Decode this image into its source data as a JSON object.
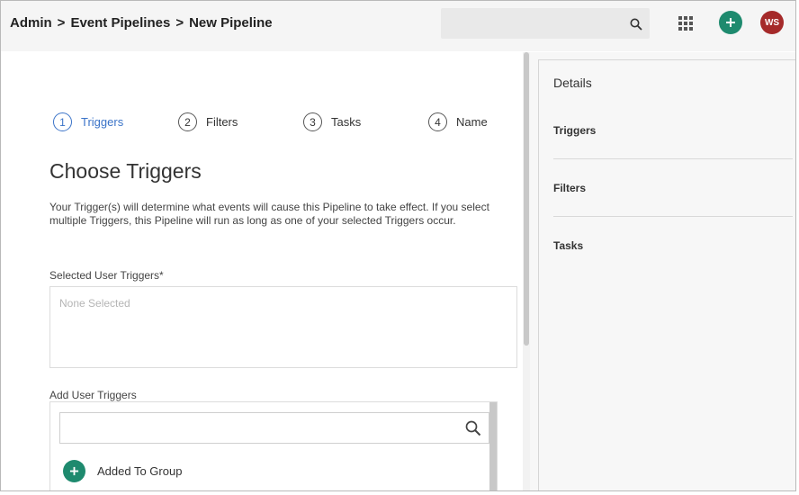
{
  "breadcrumb": [
    "Admin",
    "Event Pipelines",
    "New Pipeline"
  ],
  "breadcrumb_sep": ">",
  "search": {
    "placeholder": "",
    "icon": "search-icon"
  },
  "header_actions": {
    "apps_icon": "apps-grid-icon",
    "add_icon": "plus-icon",
    "avatar_initials": "WS"
  },
  "steps": [
    {
      "number": "1",
      "label": "Triggers",
      "active": true
    },
    {
      "number": "2",
      "label": "Filters",
      "active": false
    },
    {
      "number": "3",
      "label": "Tasks",
      "active": false
    },
    {
      "number": "4",
      "label": "Name",
      "active": false
    }
  ],
  "main": {
    "title": "Choose Triggers",
    "description": "Your Trigger(s) will determine what events will cause this Pipeline to take effect. If you select multiple Triggers, this Pipeline will run as long as one of your selected Triggers occur.",
    "selected_label": "Selected User Triggers*",
    "selected_placeholder": "None Selected",
    "add_label": "Add User Triggers",
    "trigger_search_placeholder": "",
    "triggers": [
      "Added To Group"
    ]
  },
  "details": {
    "title": "Details",
    "sections": [
      "Triggers",
      "Filters",
      "Tasks"
    ]
  },
  "colors": {
    "accent_blue": "#3a73c8",
    "green": "#1e8a6e",
    "avatar_red": "#a52a2a"
  }
}
